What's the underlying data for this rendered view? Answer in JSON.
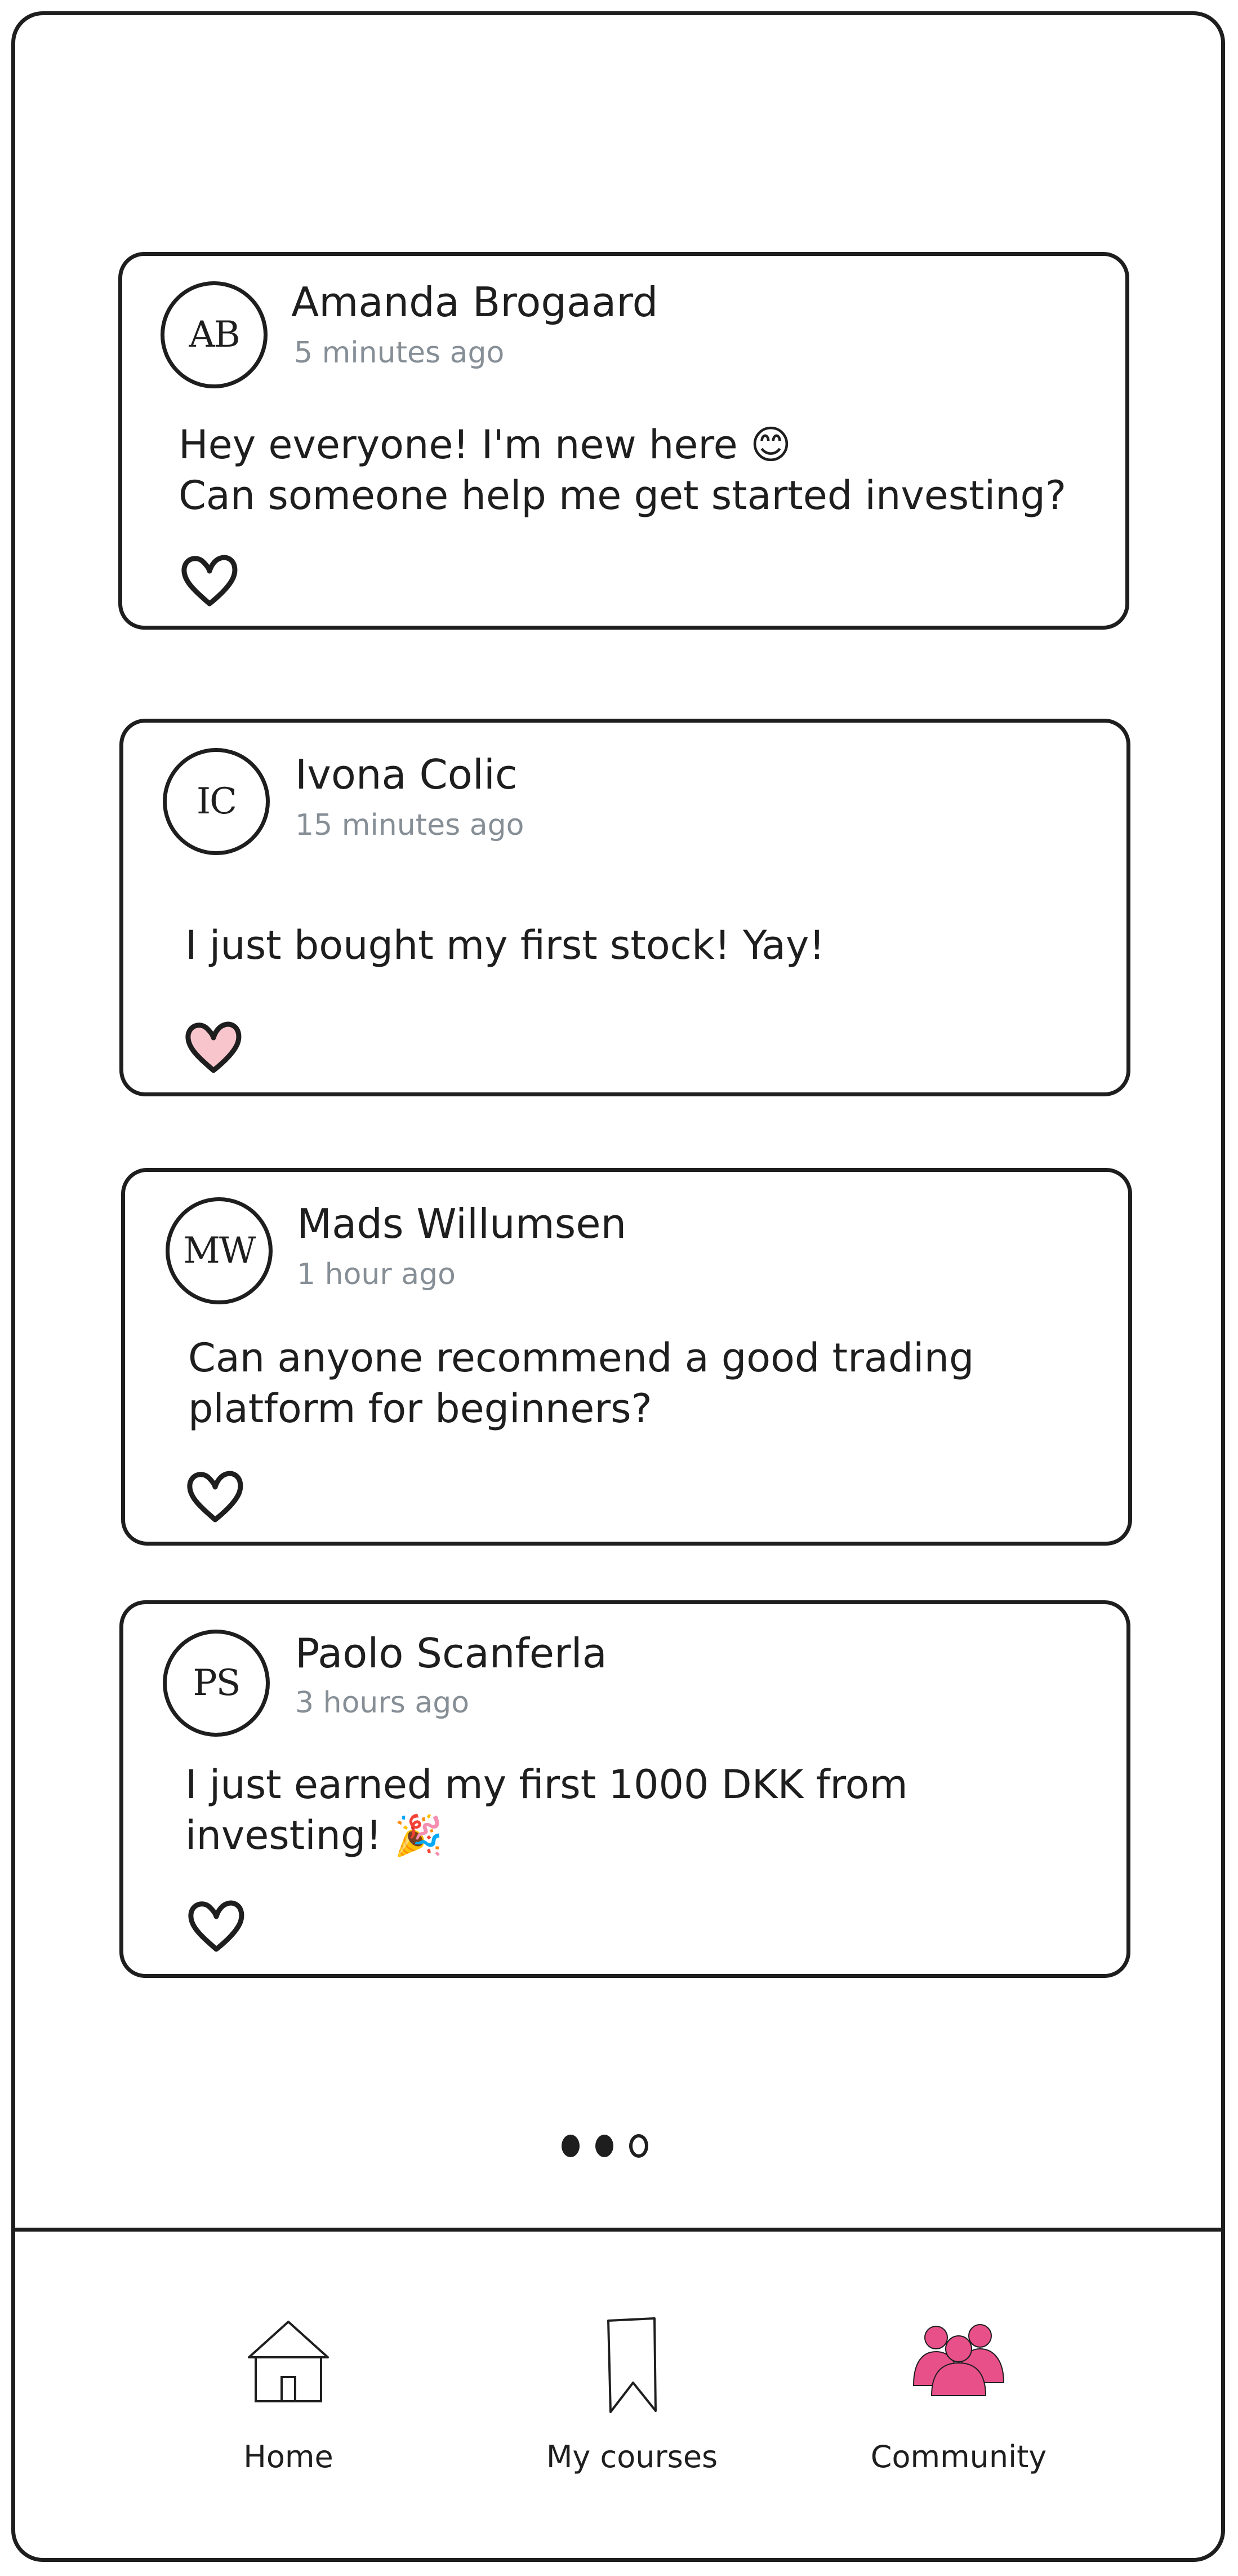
{
  "posts": [
    {
      "initials": "AB",
      "name": "Amanda Brogaard",
      "time": "5 minutes ago",
      "text": "Hey everyone! I'm new here 😊\nCan someone help me get started investing?",
      "liked": false
    },
    {
      "initials": "IC",
      "name": "Ivona Colic",
      "time": "15 minutes ago",
      "text": "I just bought my first stock! Yay!",
      "liked": true
    },
    {
      "initials": "MW",
      "name": "Mads Willumsen",
      "time": "1 hour ago",
      "text": "Can anyone recommend a good trading\nplatform for beginners?",
      "liked": false
    },
    {
      "initials": "PS",
      "name": "Paolo Scanferla",
      "time": "3 hours ago",
      "text": "I just earned my first 1000 DKK from\ninvesting! 🎉",
      "liked": false
    }
  ],
  "pagination": {
    "total": 3,
    "active": [
      0,
      1
    ]
  },
  "nav": {
    "home": "Home",
    "courses": "My courses",
    "community": "Community",
    "active": "community"
  },
  "colors": {
    "accent": "#e8508a",
    "liked_fill": "#f8c5cc",
    "stroke": "#1e1e1e",
    "muted": "#868e96"
  },
  "icons": {
    "like": "heart-icon",
    "home": "house-icon",
    "courses": "bookmark-icon",
    "community": "people-icon"
  }
}
